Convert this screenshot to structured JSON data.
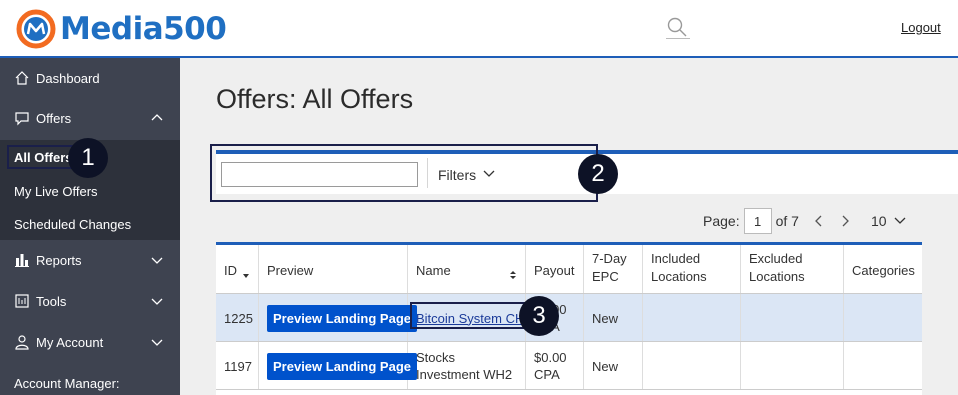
{
  "header": {
    "brand": "Media500",
    "logout_label": "Logout",
    "accent_color": "#1e5eb8"
  },
  "sidebar": {
    "dashboard": "Dashboard",
    "offers": "Offers",
    "offers_sub": [
      "All Offers",
      "My Live Offers",
      "Scheduled Changes"
    ],
    "reports": "Reports",
    "tools": "Tools",
    "my_account": "My Account",
    "account_manager": "Account Manager:"
  },
  "main": {
    "title": "Offers: All Offers",
    "search_value": "",
    "filters_label": "Filters"
  },
  "pager": {
    "page_label": "Page:",
    "current_page": "1",
    "of_label": "of 7",
    "per_page": "10"
  },
  "table": {
    "headers": [
      "ID",
      "Preview",
      "Name",
      "Payout",
      "7-Day EPC",
      "Included Locations",
      "Excluded Locations",
      "Categories"
    ],
    "rows": [
      {
        "id": "1225",
        "preview": "Preview Landing Page",
        "name": "Bitcoin System CH",
        "payout": "$0.00 CPA",
        "epc": "New"
      },
      {
        "id": "1197",
        "preview": "Preview Landing Page",
        "name": "Stocks Investment WH2",
        "payout": "$0.00 CPA",
        "epc": "New"
      }
    ]
  },
  "annotations": [
    "1",
    "2",
    "3"
  ]
}
